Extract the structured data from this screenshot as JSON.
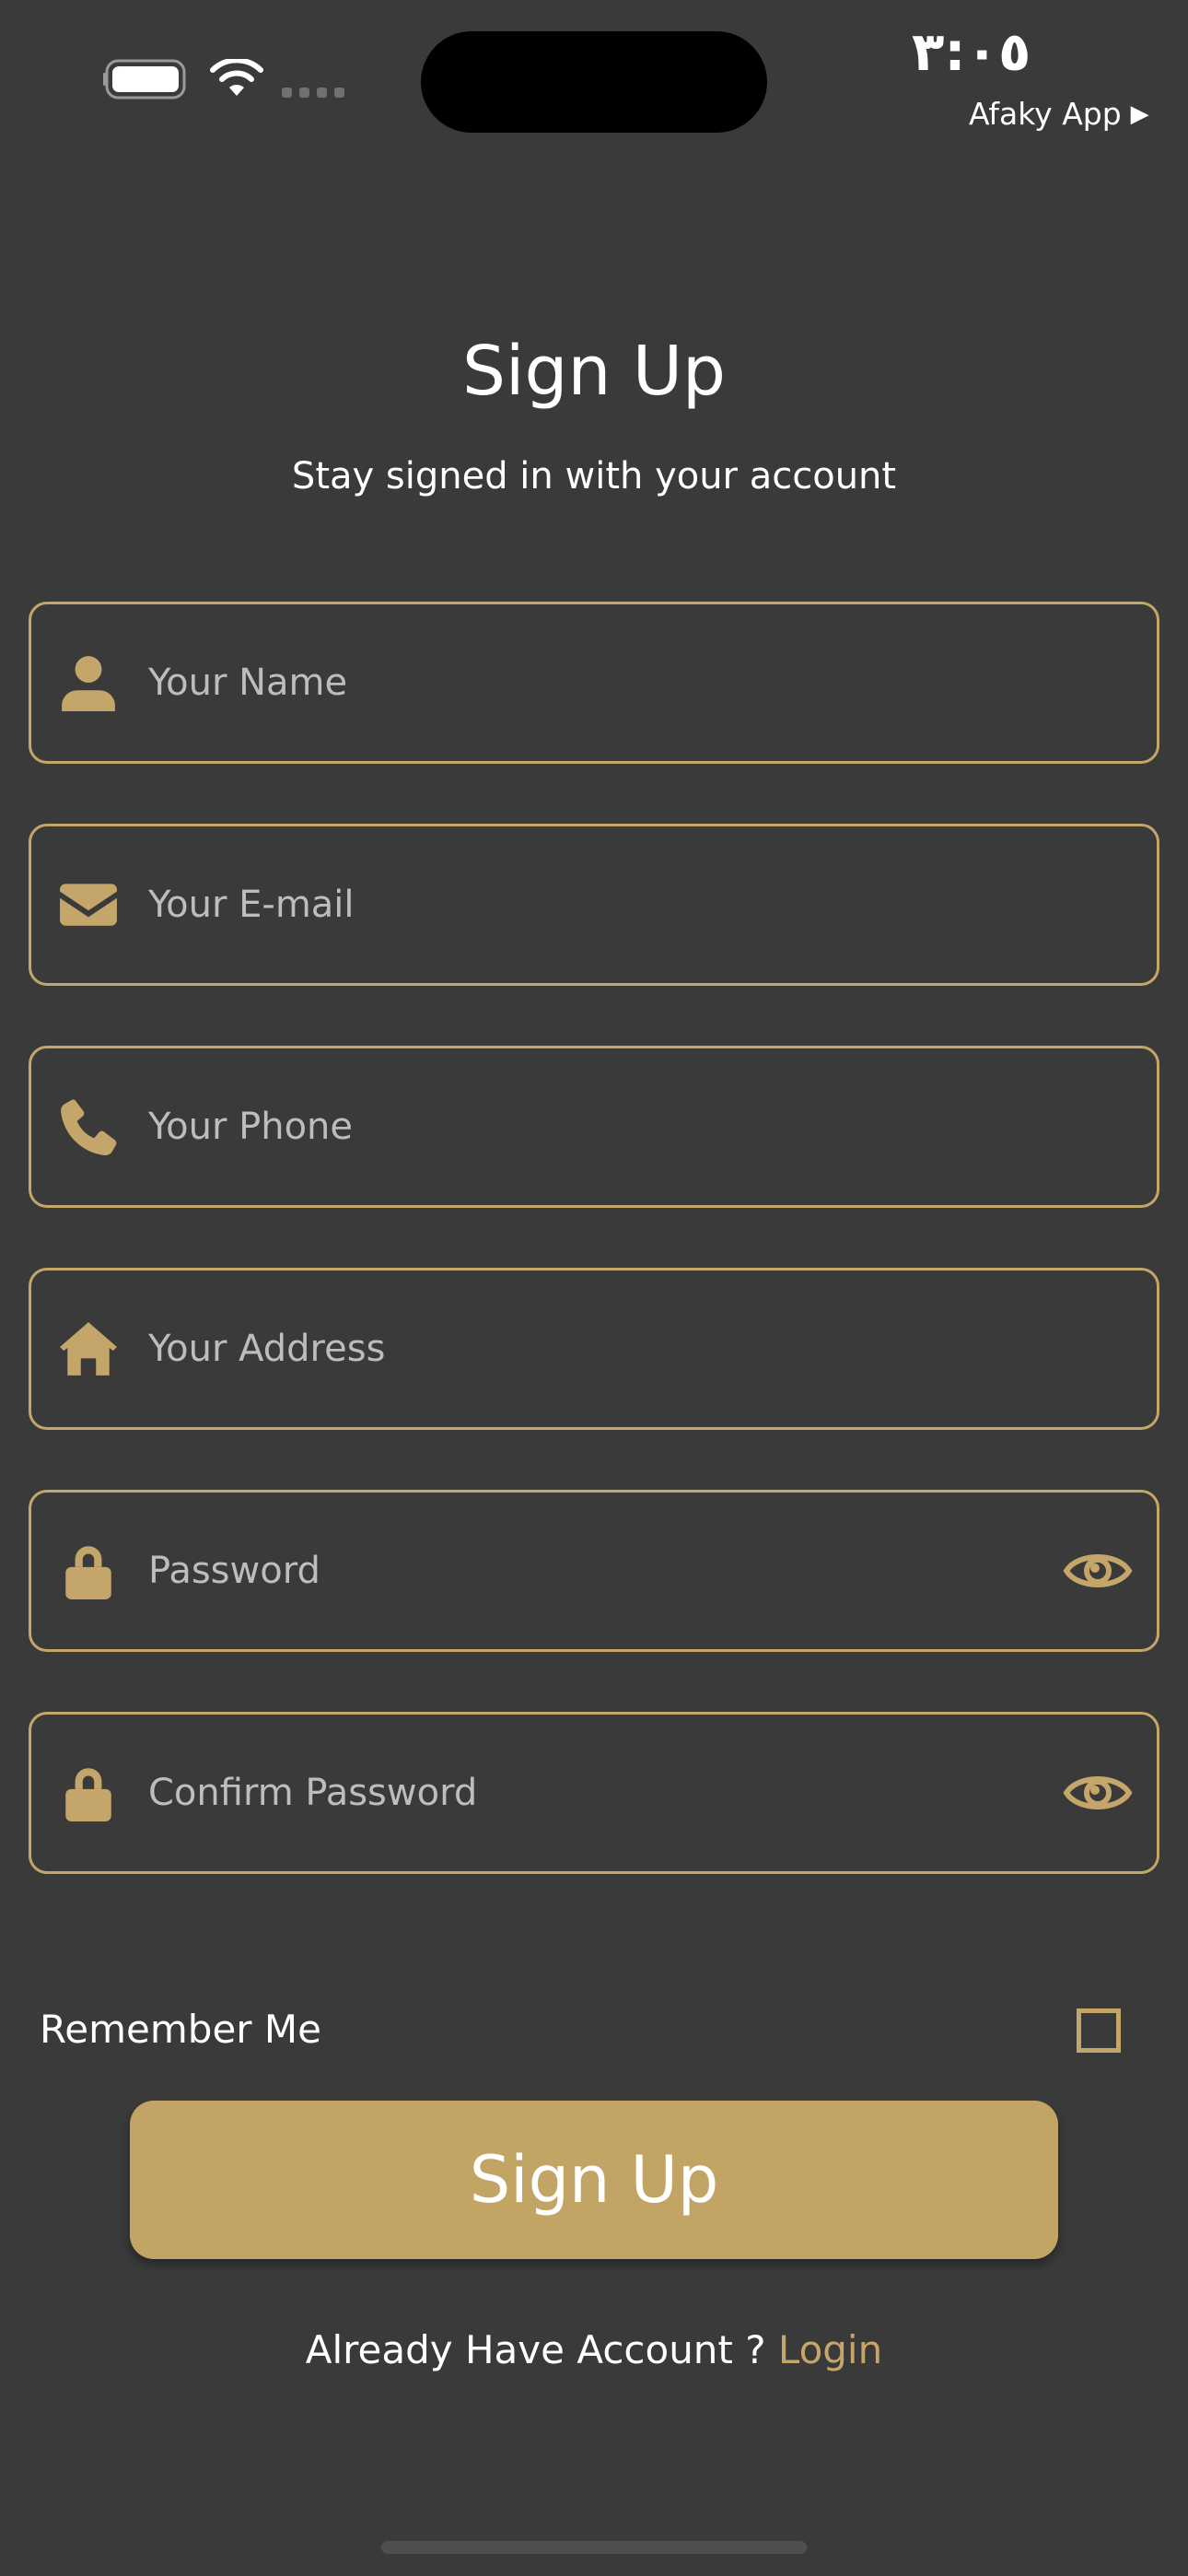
{
  "status_bar": {
    "time": "٣:٠٥",
    "back_app": "Afaky App",
    "back_arrow": "▶"
  },
  "header": {
    "title": "Sign Up",
    "subtitle": "Stay signed in with your account"
  },
  "form": {
    "name_placeholder": "Your Name",
    "email_placeholder": "Your E-mail",
    "phone_placeholder": "Your Phone",
    "address_placeholder": "Your Address",
    "password_placeholder": "Password",
    "confirm_password_placeholder": "Confirm Password",
    "remember_label": "Remember Me",
    "remember_checked": false,
    "submit_label": "Sign Up"
  },
  "footer": {
    "prompt": "Already Have Account ? ",
    "login_label": "Login"
  },
  "colors": {
    "background": "#3a3a3a",
    "accent": "#c4a66a",
    "button": "#c2a465",
    "text": "#ffffff",
    "placeholder": "#bdbdbd"
  },
  "icons": {
    "name": "user-icon",
    "email": "envelope-icon",
    "phone": "phone-icon",
    "address": "home-icon",
    "password": "lock-icon",
    "toggle": "eye-icon"
  }
}
